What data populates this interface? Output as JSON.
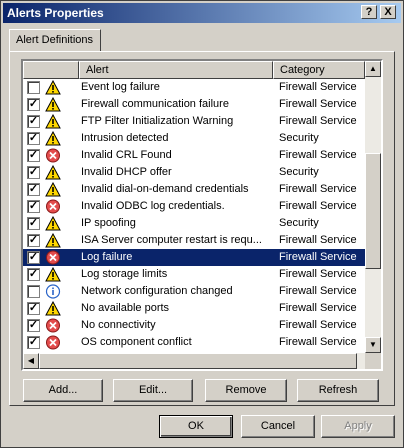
{
  "window": {
    "title": "Alerts Properties"
  },
  "titlebar_buttons": {
    "help": "?",
    "close": "X"
  },
  "tabs": [
    {
      "label": "Alert Definitions"
    }
  ],
  "list": {
    "columns": [
      {
        "label": ""
      },
      {
        "label": "Alert"
      },
      {
        "label": "Category"
      }
    ],
    "rows": [
      {
        "checked": false,
        "icon": "warning-icon",
        "alert": "Event log failure",
        "category": "Firewall Service"
      },
      {
        "checked": true,
        "icon": "warning-icon",
        "alert": "Firewall communication failure",
        "category": "Firewall Service"
      },
      {
        "checked": true,
        "icon": "warning-icon",
        "alert": "FTP Filter Initialization Warning",
        "category": "Firewall Service"
      },
      {
        "checked": true,
        "icon": "warning-icon",
        "alert": "Intrusion detected",
        "category": "Security"
      },
      {
        "checked": true,
        "icon": "error-icon",
        "alert": "Invalid CRL Found",
        "category": "Firewall Service"
      },
      {
        "checked": true,
        "icon": "warning-icon",
        "alert": "Invalid DHCP offer",
        "category": "Security"
      },
      {
        "checked": true,
        "icon": "warning-icon",
        "alert": "Invalid dial-on-demand credentials",
        "category": "Firewall Service"
      },
      {
        "checked": true,
        "icon": "error-icon",
        "alert": "Invalid ODBC log credentials.",
        "category": "Firewall Service"
      },
      {
        "checked": true,
        "icon": "warning-icon",
        "alert": "IP spoofing",
        "category": "Security"
      },
      {
        "checked": true,
        "icon": "warning-icon",
        "alert": "ISA Server computer restart is requ...",
        "category": "Firewall Service"
      },
      {
        "checked": true,
        "icon": "error-icon",
        "alert": "Log failure",
        "category": "Firewall Service",
        "selected": true
      },
      {
        "checked": true,
        "icon": "warning-icon",
        "alert": "Log storage limits",
        "category": "Firewall Service"
      },
      {
        "checked": false,
        "icon": "info-icon",
        "alert": "Network configuration changed",
        "category": "Firewall Service"
      },
      {
        "checked": true,
        "icon": "warning-icon",
        "alert": "No available ports",
        "category": "Firewall Service"
      },
      {
        "checked": true,
        "icon": "error-icon",
        "alert": "No connectivity",
        "category": "Firewall Service"
      },
      {
        "checked": true,
        "icon": "error-icon",
        "alert": "OS component conflict",
        "category": "Firewall Service"
      }
    ]
  },
  "panel_buttons": {
    "add": "Add...",
    "edit": "Edit...",
    "remove": "Remove",
    "refresh": "Refresh"
  },
  "dialog_buttons": {
    "ok": "OK",
    "cancel": "Cancel",
    "apply": "Apply"
  },
  "scroll": {
    "up": "▲",
    "down": "▼",
    "left": "◀",
    "right": "▶"
  },
  "colors": {
    "titlebar_start": "#0a246a",
    "titlebar_end": "#a6caf0",
    "selection": "#0a246a",
    "face": "#d4d0c8",
    "warning": "#ffd800",
    "error": "#e34c4c",
    "info": "#2a64c8"
  }
}
